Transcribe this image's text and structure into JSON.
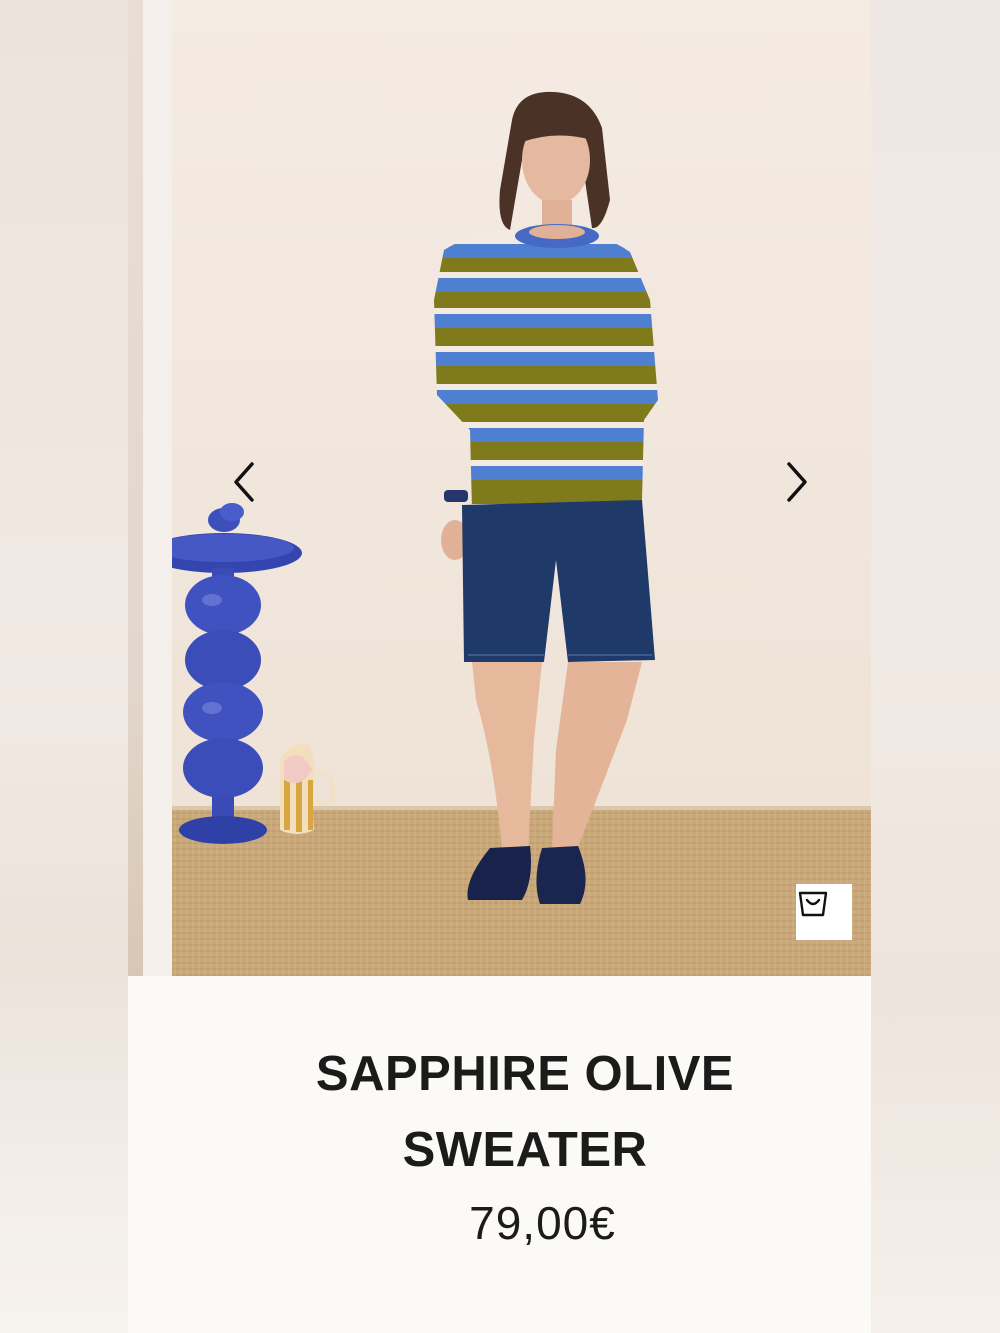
{
  "product": {
    "title_line1": "SAPPHIRE OLIVE",
    "title_line2": "SWEATER",
    "price": "79,00€"
  },
  "gallery": {
    "prev_icon": "chevron-left-icon",
    "next_icon": "chevron-right-icon",
    "cart_icon": "shopping-bag-icon"
  },
  "colors": {
    "stripe_olive": "#7f7a1c",
    "stripe_blue": "#4f7fd0",
    "denim": "#1f3a68",
    "ceramic_blue": "#3f52b8",
    "floor_jute": "#c8a878"
  }
}
